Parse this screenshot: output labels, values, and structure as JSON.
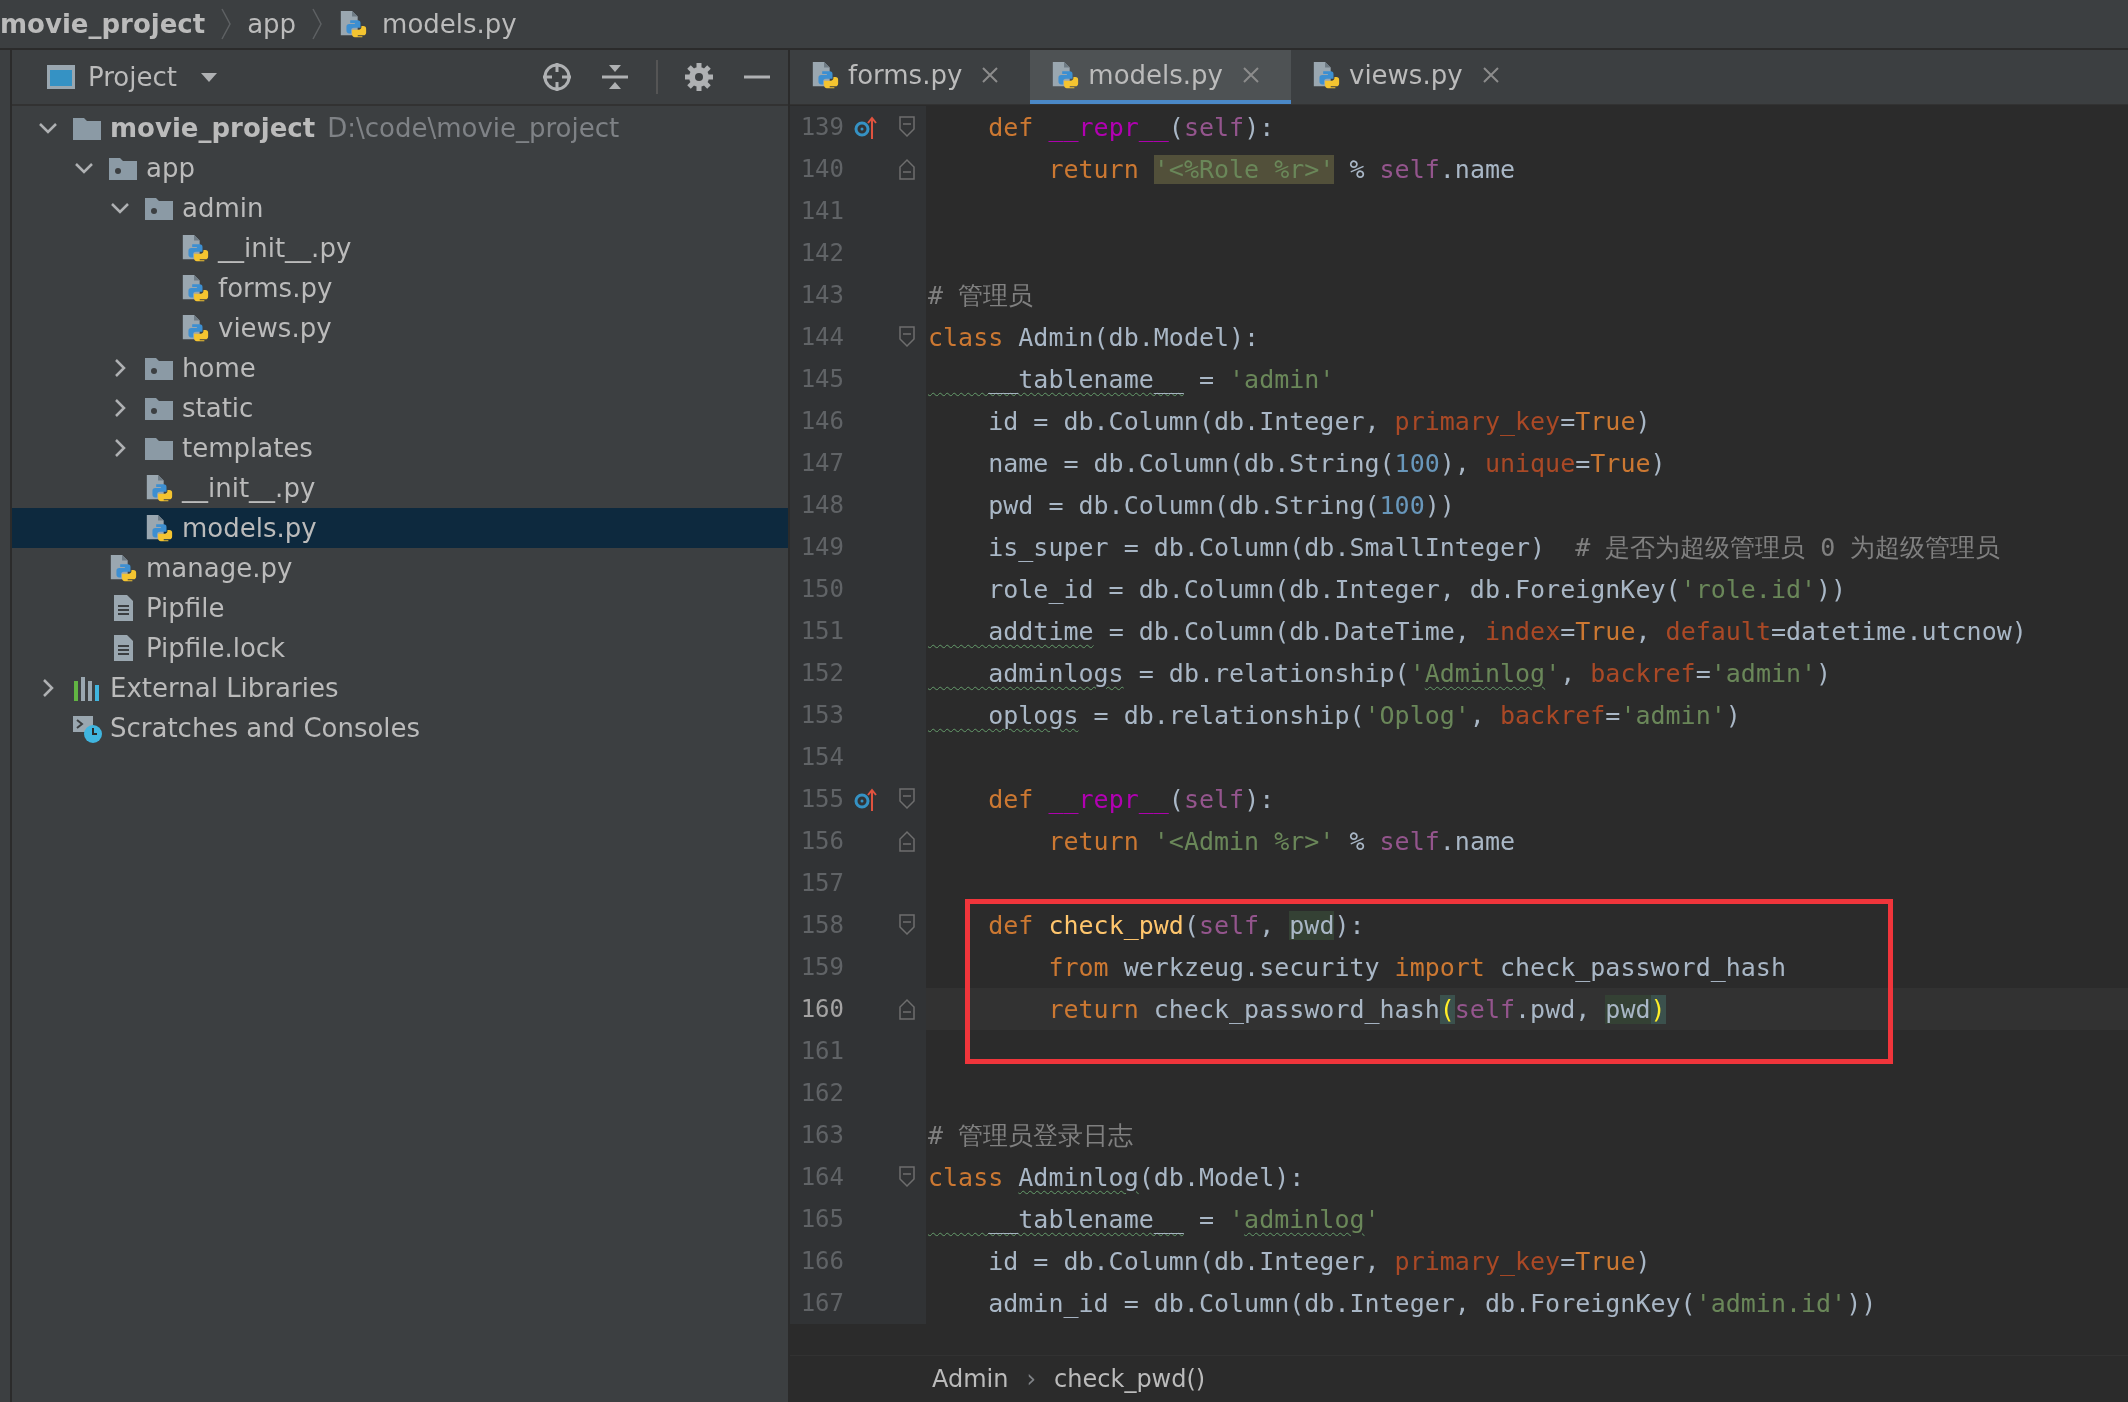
{
  "breadcrumb": [
    {
      "text": "movie_project",
      "kind": "project"
    },
    {
      "text": "app",
      "kind": "folder"
    },
    {
      "text": "models.py",
      "kind": "python"
    }
  ],
  "project_panel": {
    "title": "Project",
    "tree": [
      {
        "name": "movie_project",
        "path": "D:\\code\\movie_project",
        "kind": "folder",
        "expanded": true,
        "selected": false,
        "children": [
          {
            "name": "app",
            "kind": "package",
            "expanded": true,
            "selected": false,
            "children": [
              {
                "name": "admin",
                "kind": "package",
                "expanded": true,
                "selected": false,
                "children": [
                  {
                    "name": "__init__.py",
                    "kind": "python",
                    "selected": false
                  },
                  {
                    "name": "forms.py",
                    "kind": "python",
                    "selected": false
                  },
                  {
                    "name": "views.py",
                    "kind": "python",
                    "selected": false
                  }
                ]
              },
              {
                "name": "home",
                "kind": "package",
                "expanded": false,
                "selected": false
              },
              {
                "name": "static",
                "kind": "package",
                "expanded": false,
                "selected": false
              },
              {
                "name": "templates",
                "kind": "folder",
                "expanded": false,
                "selected": false
              },
              {
                "name": "__init__.py",
                "kind": "python",
                "selected": false
              },
              {
                "name": "models.py",
                "kind": "python",
                "selected": true
              }
            ]
          },
          {
            "name": "manage.py",
            "kind": "python",
            "selected": false
          },
          {
            "name": "Pipfile",
            "kind": "text",
            "selected": false
          },
          {
            "name": "Pipfile.lock",
            "kind": "text",
            "selected": false
          }
        ]
      },
      {
        "name": "External Libraries",
        "kind": "libraries",
        "expanded": false,
        "selected": false
      },
      {
        "name": "Scratches and Consoles",
        "kind": "scratches",
        "selected": false
      }
    ]
  },
  "tabs": [
    {
      "label": "forms.py",
      "selected": false
    },
    {
      "label": "models.py",
      "selected": true
    },
    {
      "label": "views.py",
      "selected": false
    }
  ],
  "editor": {
    "lines": [
      {
        "number": "139",
        "current": false,
        "framed": false,
        "gutter": [
          {
            "kind": "override"
          },
          {
            "kind": "fold-start"
          }
        ],
        "tokens": [
          {
            "kind": "keyword",
            "text": "    def "
          },
          {
            "kind": "dunder",
            "text": "__repr__"
          },
          {
            "kind": "plain",
            "text": "("
          },
          {
            "kind": "self",
            "text": "self"
          },
          {
            "kind": "plain",
            "text": "):"
          }
        ]
      },
      {
        "number": "140",
        "current": false,
        "framed": false,
        "gutter": [
          {
            "kind": "fold-end"
          }
        ],
        "tokens": [
          {
            "kind": "keyword",
            "text": "        return "
          },
          {
            "kind": "string-match",
            "text": "'<%Role %r>'"
          },
          {
            "kind": "plain",
            "text": " % "
          },
          {
            "kind": "self",
            "text": "self"
          },
          {
            "kind": "plain",
            "text": ".name"
          }
        ]
      },
      {
        "number": "141",
        "current": false,
        "framed": false
      },
      {
        "number": "142",
        "current": false,
        "framed": false
      },
      {
        "number": "143",
        "current": false,
        "framed": false,
        "tokens": [
          {
            "kind": "comment",
            "text": "# 管理员"
          }
        ]
      },
      {
        "number": "144",
        "current": false,
        "framed": false,
        "gutter": [
          {
            "kind": "fold-start"
          }
        ],
        "tokens": [
          {
            "kind": "keyword",
            "text": "class"
          },
          {
            "kind": "plain",
            "text": " Admin(db.Model):"
          }
        ]
      },
      {
        "number": "145",
        "current": false,
        "framed": false,
        "tokens": [
          {
            "kind": "plain-typo",
            "text": "    __tablename__"
          },
          {
            "kind": "plain",
            "text": " = "
          },
          {
            "kind": "string",
            "text": "'admin'"
          }
        ]
      },
      {
        "number": "146",
        "current": false,
        "framed": false,
        "tokens": [
          {
            "kind": "plain",
            "text": "    id = db.Column(db.Integer, "
          },
          {
            "kind": "kwarg",
            "text": "primary_key"
          },
          {
            "kind": "plain",
            "text": "="
          },
          {
            "kind": "keyword",
            "text": "True"
          },
          {
            "kind": "plain",
            "text": ")"
          }
        ]
      },
      {
        "number": "147",
        "current": false,
        "framed": false,
        "tokens": [
          {
            "kind": "plain",
            "text": "    name = db.Column(db.String("
          },
          {
            "kind": "number",
            "text": "100"
          },
          {
            "kind": "plain",
            "text": "), "
          },
          {
            "kind": "kwarg",
            "text": "unique"
          },
          {
            "kind": "plain",
            "text": "="
          },
          {
            "kind": "keyword",
            "text": "True"
          },
          {
            "kind": "plain",
            "text": ")"
          }
        ]
      },
      {
        "number": "148",
        "current": false,
        "framed": false,
        "tokens": [
          {
            "kind": "plain",
            "text": "    pwd = db.Column(db.String("
          },
          {
            "kind": "number",
            "text": "100"
          },
          {
            "kind": "plain",
            "text": "))"
          }
        ]
      },
      {
        "number": "149",
        "current": false,
        "framed": false,
        "tokens": [
          {
            "kind": "plain",
            "text": "    is_super = db.Column(db.SmallInteger)  "
          },
          {
            "kind": "comment",
            "text": "# 是否为超级管理员 0 为超级管理员"
          }
        ]
      },
      {
        "number": "150",
        "current": false,
        "framed": false,
        "tokens": [
          {
            "kind": "plain",
            "text": "    role_id = db.Column(db.Integer, db.ForeignKey("
          },
          {
            "kind": "string",
            "text": "'role.id'"
          },
          {
            "kind": "plain",
            "text": "))"
          }
        ]
      },
      {
        "number": "151",
        "current": false,
        "framed": false,
        "tokens": [
          {
            "kind": "plain-typo",
            "text": "    addtime"
          },
          {
            "kind": "plain",
            "text": " = db.Column(db.DateTime, "
          },
          {
            "kind": "kwarg",
            "text": "index"
          },
          {
            "kind": "plain",
            "text": "="
          },
          {
            "kind": "keyword",
            "text": "True"
          },
          {
            "kind": "plain",
            "text": ", "
          },
          {
            "kind": "kwarg",
            "text": "default"
          },
          {
            "kind": "plain",
            "text": "=datetime.utcnow)"
          }
        ]
      },
      {
        "number": "152",
        "current": false,
        "framed": false,
        "tokens": [
          {
            "kind": "plain-typo",
            "text": "    adminlogs"
          },
          {
            "kind": "plain",
            "text": " = db.relationship("
          },
          {
            "kind": "string",
            "text": "'"
          },
          {
            "kind": "string-typo",
            "text": "Adminlog"
          },
          {
            "kind": "string",
            "text": "'"
          },
          {
            "kind": "plain",
            "text": ", "
          },
          {
            "kind": "kwarg",
            "text": "backref"
          },
          {
            "kind": "plain",
            "text": "="
          },
          {
            "kind": "string",
            "text": "'admin'"
          },
          {
            "kind": "plain",
            "text": ")"
          }
        ]
      },
      {
        "number": "153",
        "current": false,
        "framed": false,
        "tokens": [
          {
            "kind": "plain-typo",
            "text": "    oplogs"
          },
          {
            "kind": "plain",
            "text": " = db.relationship("
          },
          {
            "kind": "string",
            "text": "'Oplog'"
          },
          {
            "kind": "plain",
            "text": ", "
          },
          {
            "kind": "kwarg",
            "text": "backref"
          },
          {
            "kind": "plain",
            "text": "="
          },
          {
            "kind": "string",
            "text": "'admin'"
          },
          {
            "kind": "plain",
            "text": ")"
          }
        ]
      },
      {
        "number": "154",
        "current": false,
        "framed": false
      },
      {
        "number": "155",
        "current": false,
        "framed": false,
        "gutter": [
          {
            "kind": "override"
          },
          {
            "kind": "fold-start"
          }
        ],
        "tokens": [
          {
            "kind": "keyword",
            "text": "    def "
          },
          {
            "kind": "dunder",
            "text": "__repr__"
          },
          {
            "kind": "plain",
            "text": "("
          },
          {
            "kind": "self",
            "text": "self"
          },
          {
            "kind": "plain",
            "text": "):"
          }
        ]
      },
      {
        "number": "156",
        "current": false,
        "framed": false,
        "gutter": [
          {
            "kind": "fold-end"
          }
        ],
        "tokens": [
          {
            "kind": "keyword",
            "text": "        return "
          },
          {
            "kind": "string",
            "text": "'<Admin %r>'"
          },
          {
            "kind": "plain",
            "text": " % "
          },
          {
            "kind": "self",
            "text": "self"
          },
          {
            "kind": "plain",
            "text": ".name"
          }
        ]
      },
      {
        "number": "157",
        "current": false,
        "framed": false
      },
      {
        "number": "158",
        "current": false,
        "framed": true,
        "gutter": [
          {
            "kind": "fold-start"
          }
        ],
        "tokens": [
          {
            "kind": "keyword",
            "text": "    def "
          },
          {
            "kind": "function",
            "text": "check_pwd"
          },
          {
            "kind": "plain",
            "text": "("
          },
          {
            "kind": "self",
            "text": "self"
          },
          {
            "kind": "plain",
            "text": ", "
          },
          {
            "kind": "usage",
            "text": "pwd"
          },
          {
            "kind": "plain",
            "text": "):"
          }
        ]
      },
      {
        "number": "159",
        "current": false,
        "framed": true,
        "tokens": [
          {
            "kind": "keyword",
            "text": "        from"
          },
          {
            "kind": "plain",
            "text": " werkzeug.security "
          },
          {
            "kind": "keyword",
            "text": "import"
          },
          {
            "kind": "plain",
            "text": " check_password_hash"
          }
        ]
      },
      {
        "number": "160",
        "current": true,
        "framed": true,
        "gutter": [
          {
            "kind": "fold-end"
          }
        ],
        "tokens": [
          {
            "kind": "keyword",
            "text": "        return"
          },
          {
            "kind": "plain",
            "text": " check_password_hash"
          },
          {
            "kind": "brace",
            "text": "("
          },
          {
            "kind": "self",
            "text": "self"
          },
          {
            "kind": "plain",
            "text": ".pwd, "
          },
          {
            "kind": "usage",
            "text": "pwd"
          },
          {
            "kind": "brace",
            "text": ")"
          }
        ]
      },
      {
        "number": "161",
        "current": false,
        "framed": true
      },
      {
        "number": "162",
        "current": false,
        "framed": false
      },
      {
        "number": "163",
        "current": false,
        "framed": false,
        "tokens": [
          {
            "kind": "comment",
            "text": "# 管理员登录日志"
          }
        ]
      },
      {
        "number": "164",
        "current": false,
        "framed": false,
        "gutter": [
          {
            "kind": "fold-start"
          }
        ],
        "tokens": [
          {
            "kind": "keyword",
            "text": "class "
          },
          {
            "kind": "plain-typo",
            "text": "Adminlog"
          },
          {
            "kind": "plain",
            "text": "(db.Model):"
          }
        ]
      },
      {
        "number": "165",
        "current": false,
        "framed": false,
        "tokens": [
          {
            "kind": "plain-typo",
            "text": "    __tablename__"
          },
          {
            "kind": "plain",
            "text": " = "
          },
          {
            "kind": "string",
            "text": "'"
          },
          {
            "kind": "string-typo",
            "text": "adminlog"
          },
          {
            "kind": "string",
            "text": "'"
          }
        ]
      },
      {
        "number": "166",
        "current": false,
        "framed": false,
        "tokens": [
          {
            "kind": "plain",
            "text": "    id = db.Column(db.Integer, "
          },
          {
            "kind": "kwarg",
            "text": "primary_key"
          },
          {
            "kind": "plain",
            "text": "="
          },
          {
            "kind": "keyword",
            "text": "True"
          },
          {
            "kind": "plain",
            "text": ")"
          }
        ]
      },
      {
        "number": "167",
        "current": false,
        "framed": false,
        "tokens": [
          {
            "kind": "plain",
            "text": "    admin_id = db.Column(db.Integer, db.ForeignKey("
          },
          {
            "kind": "string",
            "text": "'admin.id'"
          },
          {
            "kind": "plain",
            "text": "))"
          }
        ]
      }
    ]
  },
  "status_breadcrumb": [
    {
      "text": "Admin"
    },
    {
      "text": "›",
      "kind": "separator"
    },
    {
      "text": "check_pwd()"
    }
  ]
}
